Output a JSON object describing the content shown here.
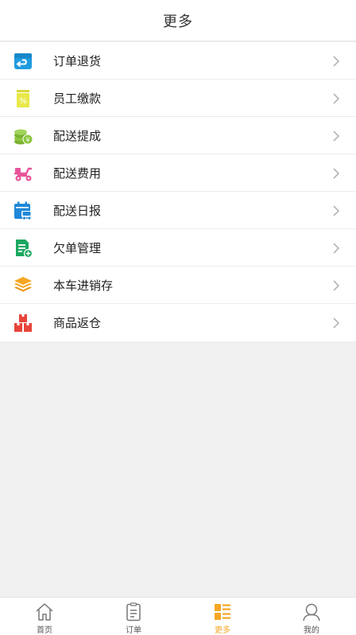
{
  "header": {
    "title": "更多"
  },
  "menu": {
    "items": [
      {
        "label": "订单退货",
        "icon": "order-return-icon",
        "color": "#1e9be0"
      },
      {
        "label": "员工缴款",
        "icon": "employee-payment-icon",
        "color": "#e8e84a"
      },
      {
        "label": "配送提成",
        "icon": "coins-icon",
        "color": "#8dc63f"
      },
      {
        "label": "配送费用",
        "icon": "scooter-icon",
        "color": "#e8549a"
      },
      {
        "label": "配送日报",
        "icon": "calendar-truck-icon",
        "color": "#1e88d8"
      },
      {
        "label": "欠单管理",
        "icon": "document-add-icon",
        "color": "#1aa860"
      },
      {
        "label": "本车进销存",
        "icon": "layers-icon",
        "color": "#f5a623"
      },
      {
        "label": "商品返仓",
        "icon": "boxes-icon",
        "color": "#e8443a"
      }
    ]
  },
  "tabbar": {
    "tabs": [
      {
        "label": "首页",
        "icon": "home-icon"
      },
      {
        "label": "订单",
        "icon": "clipboard-icon"
      },
      {
        "label": "更多",
        "icon": "more-grid-icon",
        "active": true
      },
      {
        "label": "我的",
        "icon": "user-icon"
      }
    ],
    "active_color": "#f5a623"
  }
}
